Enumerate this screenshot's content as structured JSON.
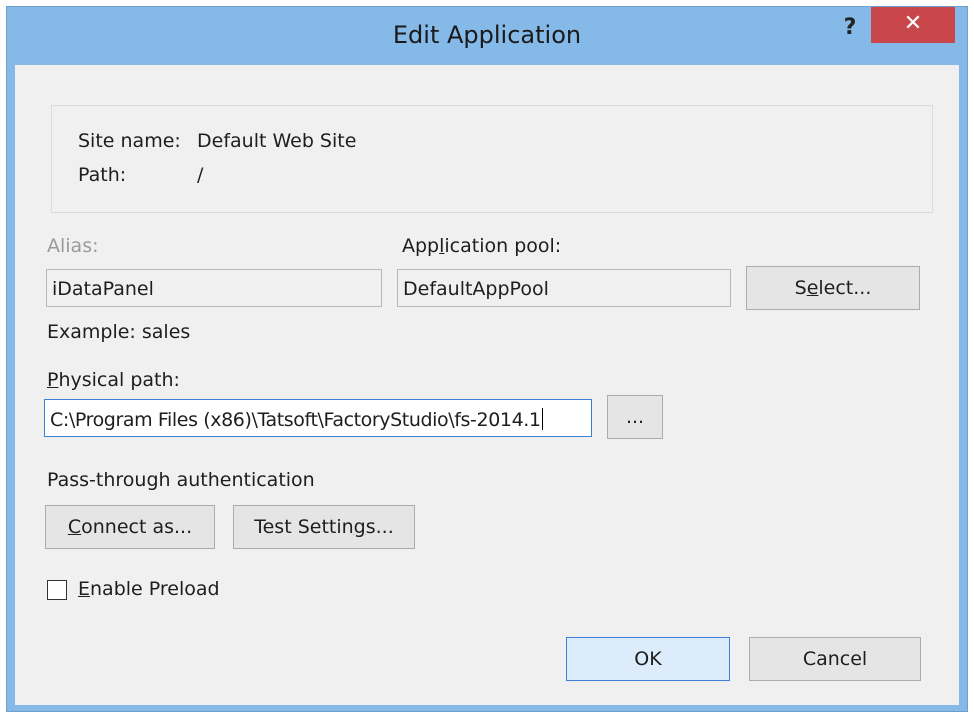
{
  "dialog": {
    "title": "Edit Application",
    "help_glyph": "?",
    "close_glyph": "✕"
  },
  "info": {
    "site_name_label": "Site name:",
    "site_name_value": "Default Web Site",
    "path_label": "Path:",
    "path_value": "/"
  },
  "alias": {
    "label": "Alias:",
    "value": "iDataPanel",
    "example": "Example: sales"
  },
  "app_pool": {
    "label_pre": "App",
    "label_u": "l",
    "label_post": "ication pool:",
    "value": "DefaultAppPool",
    "select_pre": "S",
    "select_u": "e",
    "select_post": "lect..."
  },
  "physical_path": {
    "label_u": "P",
    "label_post": "hysical path:",
    "value": "C:\\Program Files (x86)\\Tatsoft\\FactoryStudio\\fs-2014.1",
    "browse_label": "..."
  },
  "auth": {
    "heading": "Pass-through authentication",
    "connect_u": "C",
    "connect_post": "onnect as...",
    "test_pre": "Test Settin",
    "test_u": "g",
    "test_post": "s..."
  },
  "preload": {
    "label_u": "E",
    "label_post": "nable Preload",
    "checked": false
  },
  "footer": {
    "ok_label": "OK",
    "cancel_label": "Cancel"
  },
  "colors": {
    "frame": "#85b9e8",
    "close": "#c9474a",
    "client": "#f0f0f0",
    "focus_border": "#3c7fd6"
  }
}
